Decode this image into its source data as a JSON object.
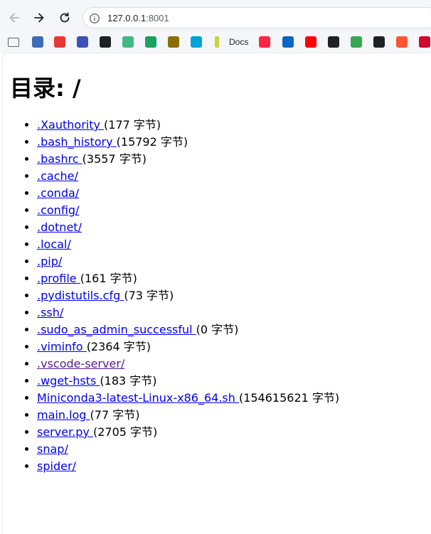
{
  "browser": {
    "url_host": "127.0.0.1",
    "url_port": ":8001",
    "bookmarks": [
      {
        "icon": "folder-icon",
        "color": "#5f6368"
      },
      {
        "icon": "university-seal-icon",
        "color": "#3b6cb7"
      },
      {
        "icon": "heart-bookmark-icon",
        "color": "#e53935"
      },
      {
        "icon": "round-logo-icon",
        "color": "#3f51b5"
      },
      {
        "icon": "square-dark-icon",
        "color": "#202124"
      },
      {
        "icon": "vue-icon",
        "color": "#41b883"
      },
      {
        "icon": "sheet-green-icon",
        "color": "#1aa260"
      },
      {
        "icon": "yellow-text-icon",
        "color": "#8a6d00"
      },
      {
        "icon": "bilibili-icon",
        "color": "#00a1d6"
      },
      {
        "icon": "docs-icon",
        "color": "#c6d33a",
        "label": "Docs"
      },
      {
        "icon": "xiaohongshu-icon",
        "color": "#ff2442"
      },
      {
        "icon": "zhihu-icon",
        "color": "#0a66c2"
      },
      {
        "icon": "youtube-icon",
        "color": "#ff0000"
      },
      {
        "icon": "openai-icon",
        "color": "#202124"
      },
      {
        "icon": "chrome-icon",
        "color": "#34a853"
      },
      {
        "icon": "github-icon",
        "color": "#202124"
      },
      {
        "icon": "csdn-icon",
        "color": "#fc5531"
      },
      {
        "icon": "huawei-icon",
        "color": "#cf0a2c"
      }
    ]
  },
  "page": {
    "title": "目录: /",
    "entries": [
      {
        "name": ".Xauthority ",
        "size": "(177 字节)"
      },
      {
        "name": ".bash_history ",
        "size": "(15792 字节)"
      },
      {
        "name": ".bashrc ",
        "size": "(3557 字节)"
      },
      {
        "name": ".cache/",
        "size": ""
      },
      {
        "name": ".conda/",
        "size": ""
      },
      {
        "name": ".config/",
        "size": ""
      },
      {
        "name": ".dotnet/",
        "size": ""
      },
      {
        "name": ".local/",
        "size": ""
      },
      {
        "name": ".pip/",
        "size": ""
      },
      {
        "name": ".profile ",
        "size": "(161 字节)"
      },
      {
        "name": ".pydistutils.cfg ",
        "size": "(73 字节)"
      },
      {
        "name": ".ssh/",
        "size": ""
      },
      {
        "name": ".sudo_as_admin_successful ",
        "size": "(0 字节)"
      },
      {
        "name": ".viminfo ",
        "size": "(2364 字节)"
      },
      {
        "name": ".vscode-server/",
        "size": "",
        "visited": true
      },
      {
        "name": ".wget-hsts ",
        "size": "(183 字节)"
      },
      {
        "name": "Miniconda3-latest-Linux-x86_64.sh ",
        "size": "(154615621 字节)"
      },
      {
        "name": "main.log ",
        "size": "(77 字节)"
      },
      {
        "name": "server.py ",
        "size": "(2705 字节)"
      },
      {
        "name": "snap/",
        "size": ""
      },
      {
        "name": "spider/",
        "size": ""
      }
    ]
  }
}
